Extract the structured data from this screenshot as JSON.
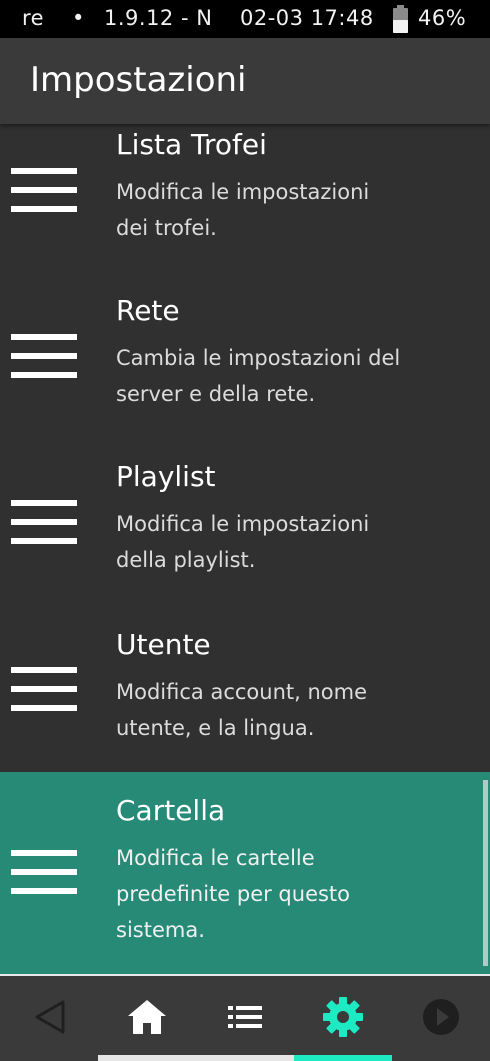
{
  "status_bar": {
    "carrier": "re",
    "separator": "•",
    "version": "1.9.12 - N",
    "datetime": "02-03 17:48",
    "battery_percent": "46%",
    "battery_level": 0.46
  },
  "app_bar": {
    "title": "Impostazioni"
  },
  "settings": {
    "items": [
      {
        "title": "Lista Trofei",
        "desc_line1": "Modifica le impostazioni",
        "desc_line2": "dei trofei.",
        "desc_line3": ""
      },
      {
        "title": "Rete",
        "desc_line1": "Cambia le impostazioni del",
        "desc_line2": "server e della rete.",
        "desc_line3": ""
      },
      {
        "title": "Playlist",
        "desc_line1": "Modifica le impostazioni",
        "desc_line2": "della playlist.",
        "desc_line3": ""
      },
      {
        "title": "Utente",
        "desc_line1": "Modifica account, nome",
        "desc_line2": "utente, e la lingua.",
        "desc_line3": ""
      },
      {
        "title": "Cartella",
        "desc_line1": "Modifica le cartelle",
        "desc_line2": "predefinite per questo",
        "desc_line3": "sistema."
      }
    ],
    "selected_index": 4
  },
  "bottom_nav": {
    "items": [
      "back-icon",
      "home-icon",
      "list-icon",
      "gear-icon",
      "play-icon"
    ],
    "active": "gear-icon"
  },
  "colors": {
    "background": "#303030",
    "app_bar": "#3a3a3a",
    "selected_row": "#268a77",
    "accent": "#1de9c3"
  }
}
